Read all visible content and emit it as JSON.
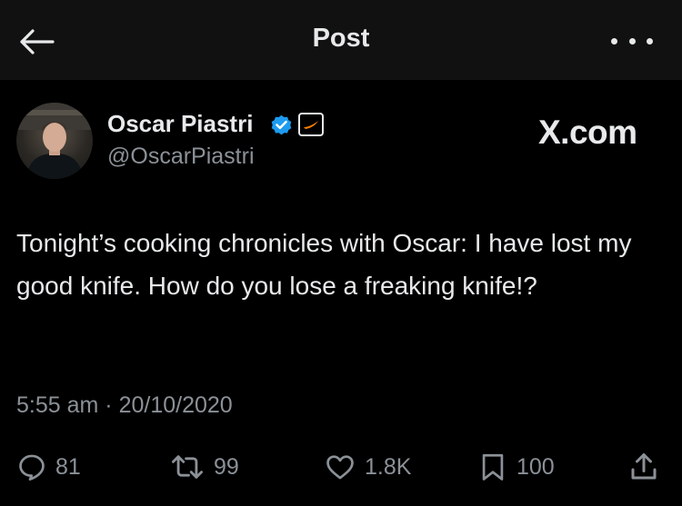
{
  "header": {
    "title": "Post",
    "back_icon": "arrow-left-icon",
    "more_icon": "more-horizontal-icon"
  },
  "author": {
    "name": "Oscar Piastri",
    "handle": "@OscarPiastri",
    "verified_icon": "verified-badge-icon",
    "affiliate_icon": "mclaren-logo-icon"
  },
  "watermark": "X.com",
  "tweet": {
    "text": "Tonight’s cooking chronicles with Oscar: I have lost my good knife. How do you lose a freaking knife!?",
    "time": "5:55 am",
    "separator": "·",
    "date": "20/10/2020"
  },
  "actions": {
    "replies": "81",
    "reposts": "99",
    "likes": "1.8K",
    "bookmarks": "100"
  },
  "colors": {
    "background": "#000000",
    "header_bg": "#111111",
    "text": "#e7e9ea",
    "secondary_text": "#8b9197",
    "verified_blue": "#1d9bf0",
    "mclaren_orange": "#ff8000"
  }
}
